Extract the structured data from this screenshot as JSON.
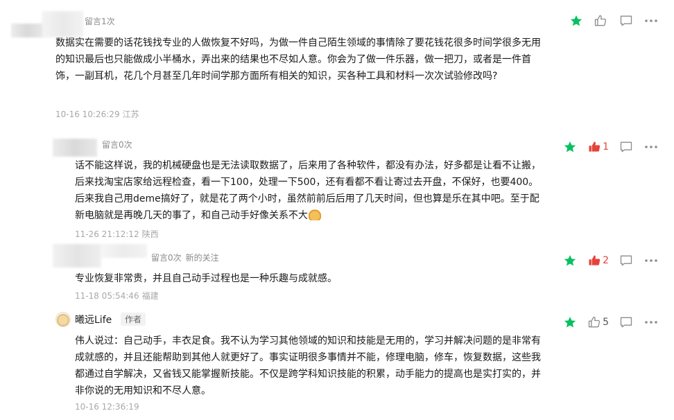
{
  "comments": [
    {
      "meta": "留言1次",
      "text": "数据实在需要的话花钱找专业的人做恢复不好吗，为做一件自己陌生领域的事情除了要花钱花很多时间学很多无用的知识最后也只能做成小半桶水，弄出来的结果也不尽如人意。你会为了做一件乐器，做一把刀，或者是一件首饰，一副耳机，花几个月甚至几年时间学那方面所有相关的知识，买各种工具和材料一次次试验修改吗?",
      "date": "10-16 10:26:29",
      "location": "江苏",
      "like_count": ""
    },
    {
      "meta": "留言0次",
      "text": "话不能这样说，我的机械硬盘也是无法读取数据了，后来用了各种软件，都没有办法，好多都是让看不让搬，后来找淘宝店家给远程检查，看一下100，处理一下500，还有看都不看让寄过去开盘，不保好，也要400。后来我自己用deme搞好了，就是花了两个小时，虽然前前后后用了几天时间，但也算是乐在其中吧。至于配新电脑就是再晚几天的事了，和自己动手好像关系不大",
      "date": "11-26 21:12:12",
      "location": "陕西",
      "like_count": "1"
    },
    {
      "meta": "留言0次",
      "meta_extra": "新的关注",
      "text": "专业恢复非常贵，并且自己动手过程也是一种乐趣与成就感。",
      "date": "11-18 05:54:46",
      "location": "福建",
      "like_count": "2"
    },
    {
      "author": "曦远Life",
      "badge": "作者",
      "text": "伟人说过：自己动手，丰衣足食。我不认为学习其他领域的知识和技能是无用的，学习并解决问题的是非常有成就感的，并且还能帮助到其他人就更好了。事实证明很多事情并不能，修理电脑，修车，恢复数据，这些我都通过自学解决，又省钱又能掌握新技能。不仅是跨学科知识技能的积累，动手能力的提高也是实打实的，并非你说的无用知识和不尽人意。",
      "date": "10-16 12:36:19",
      "like_count": "5"
    }
  ],
  "colors": {
    "star": "#07c160",
    "like_active": "#e5433a",
    "icon_gray": "#8c8c8c"
  },
  "icons": [
    "star-icon",
    "thumbs-up-icon",
    "reply-icon",
    "more-icon",
    "emoji-icon"
  ]
}
